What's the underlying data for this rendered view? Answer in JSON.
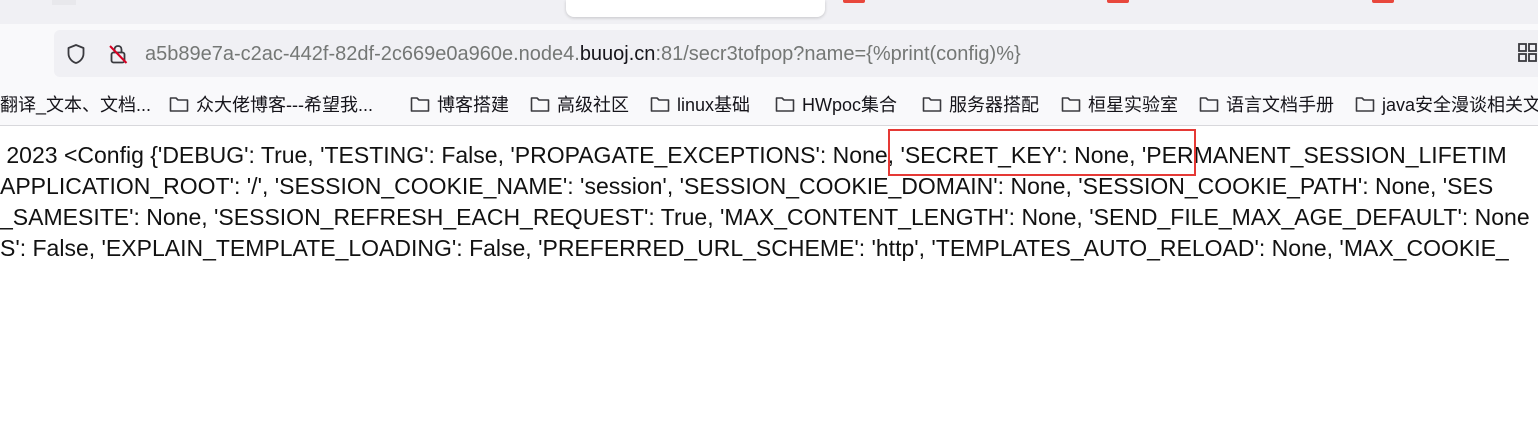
{
  "browser": {
    "url": {
      "prefix": "a5b89e7a-c2ac-442f-82df-2c669e0a960e.node4.",
      "domain": "buuoj.cn",
      "suffix": ":81/secr3tofpop?name={%print(config)%}"
    },
    "icons": [
      "shield-icon",
      "insecure-lock-icon",
      "extensions-icon"
    ],
    "accent_colors": {
      "tab_favicons": "#e8473c"
    }
  },
  "bookmarks": [
    {
      "label": "翻译_文本、文档...",
      "icon": ""
    },
    {
      "label": "众大佬博客---希望我...",
      "icon": "folder-icon"
    },
    {
      "label": "博客搭建",
      "icon": "folder-icon"
    },
    {
      "label": "高级社区",
      "icon": "folder-icon"
    },
    {
      "label": "linux基础",
      "icon": "folder-icon"
    },
    {
      "label": "HWpoc集合",
      "icon": "folder-icon"
    },
    {
      "label": "服务器搭配",
      "icon": "folder-icon"
    },
    {
      "label": "桓星实验室",
      "icon": "folder-icon"
    },
    {
      "label": "语言文档手册",
      "icon": "folder-icon"
    },
    {
      "label": "java安全漫谈相关文",
      "icon": "folder-icon"
    }
  ],
  "page": {
    "lines": [
      " 2023 <Config {'DEBUG': True, 'TESTING': False, 'PROPAGATE_EXCEPTIONS': None, 'SECRET_KEY': None, 'PERMANENT_SESSION_LIFETIM",
      "APPLICATION_ROOT': '/', 'SESSION_COOKIE_NAME': 'session', 'SESSION_COOKIE_DOMAIN': None, 'SESSION_COOKIE_PATH': None, 'SES",
      "_SAMESITE': None, 'SESSION_REFRESH_EACH_REQUEST': True, 'MAX_CONTENT_LENGTH': None, 'SEND_FILE_MAX_AGE_DEFAULT': None",
      "S': False, 'EXPLAIN_TEMPLATE_LOADING': False, 'PREFERRED_URL_SCHEME': 'http', 'TEMPLATES_AUTO_RELOAD': None, 'MAX_COOKIE_"
    ],
    "annotation_color": "#e53935"
  }
}
